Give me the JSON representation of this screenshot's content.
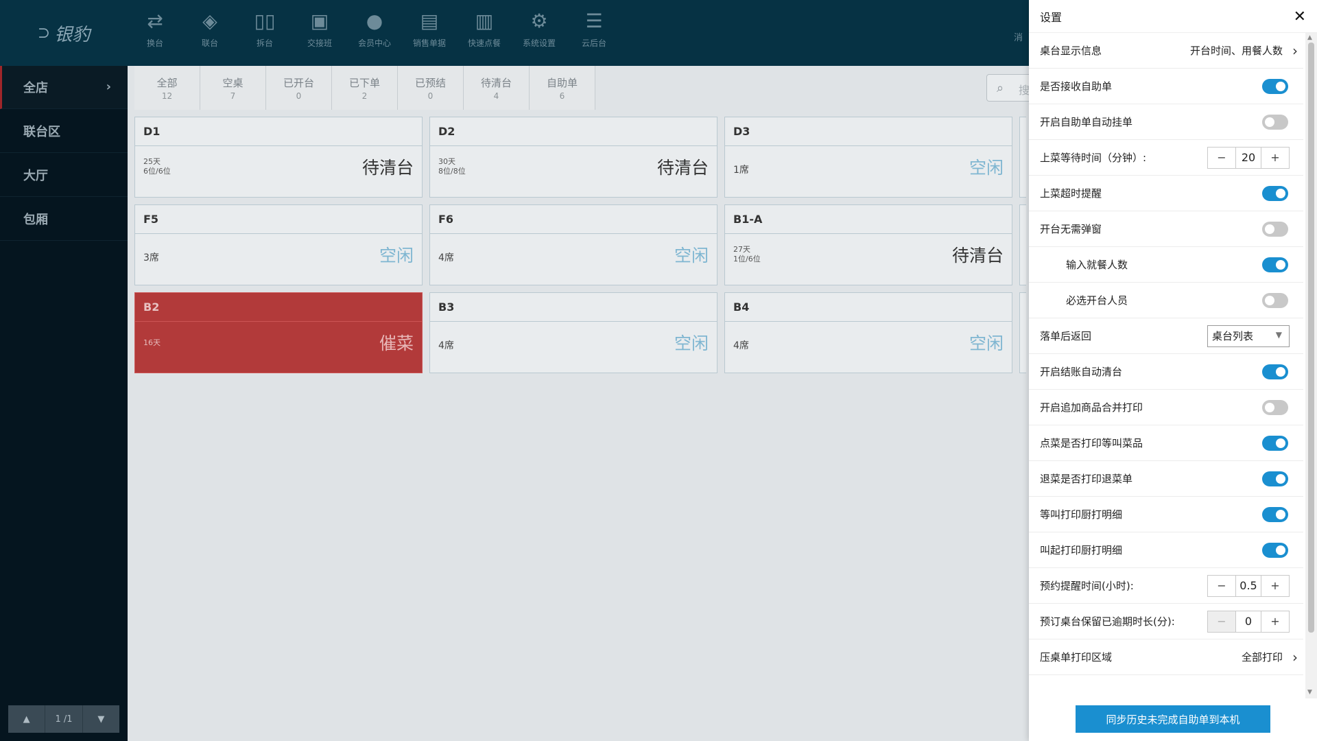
{
  "brand": {
    "name": "银豹"
  },
  "sidebar": {
    "items": [
      {
        "label": "全店",
        "active": true
      },
      {
        "label": "联台区"
      },
      {
        "label": "大厅"
      },
      {
        "label": "包厢"
      }
    ],
    "pager": {
      "page": "1 /1"
    }
  },
  "toolbar": {
    "items": [
      {
        "label": "换台",
        "icon": "swap-table-icon"
      },
      {
        "label": "联台",
        "icon": "link-table-icon"
      },
      {
        "label": "拆台",
        "icon": "split-table-icon"
      },
      {
        "label": "交接班",
        "icon": "shift-handover-icon"
      },
      {
        "label": "会员中心",
        "icon": "member-center-icon"
      },
      {
        "label": "销售单据",
        "icon": "sales-receipt-icon"
      },
      {
        "label": "快速点餐",
        "icon": "quick-order-icon"
      },
      {
        "label": "系统设置",
        "icon": "gear-icon"
      },
      {
        "label": "云后台",
        "icon": "cloud-backend-icon"
      }
    ],
    "partial_label": "消"
  },
  "filters": [
    {
      "name": "全部",
      "count": "12"
    },
    {
      "name": "空桌",
      "count": "7"
    },
    {
      "name": "已开台",
      "count": "0"
    },
    {
      "name": "已下单",
      "count": "2"
    },
    {
      "name": "已预结",
      "count": "0"
    },
    {
      "name": "待清台",
      "count": "4"
    },
    {
      "name": "自助单",
      "count": "6"
    }
  ],
  "search": {
    "partial_text": "搜"
  },
  "tables": [
    {
      "id": "D1",
      "line1": "25天",
      "line2": "6位/6位",
      "status": "待清台"
    },
    {
      "id": "D2",
      "line1": "30天",
      "line2": "8位/8位",
      "status": "待清台"
    },
    {
      "id": "D3",
      "seats": "1席",
      "status": "空闲"
    },
    {
      "id": "F5",
      "seats": "3席",
      "status": "空闲"
    },
    {
      "id": "F6",
      "seats": "4席",
      "status": "空闲"
    },
    {
      "id": "B1-A",
      "line1": "27天",
      "line2": "1位/6位",
      "status": "待清台"
    },
    {
      "id": "B2",
      "line1": "16天",
      "status": "催菜"
    },
    {
      "id": "B3",
      "seats": "4席",
      "status": "空闲"
    },
    {
      "id": "B4",
      "seats": "4席",
      "status": "空闲"
    }
  ],
  "settings": {
    "title": "设置",
    "rows": [
      {
        "label": "桌台显示信息",
        "value": "开台时间、用餐人数"
      },
      {
        "label": "是否接收自助单",
        "on": true
      },
      {
        "label": "开启自助单自动挂单",
        "on": false
      },
      {
        "label": "上菜等待时间（分钟）:",
        "value": "20"
      },
      {
        "label": "上菜超时提醒",
        "on": true
      },
      {
        "label": "开台无需弹窗",
        "on": false
      },
      {
        "label": "输入就餐人数",
        "on": true
      },
      {
        "label": "必选开台人员",
        "on": false
      },
      {
        "label": "落单后返回",
        "value": "桌台列表"
      },
      {
        "label": "开启结账自动清台",
        "on": true
      },
      {
        "label": "开启追加商品合并打印",
        "on": false
      },
      {
        "label": "点菜是否打印等叫菜品",
        "on": true
      },
      {
        "label": "退菜是否打印退菜单",
        "on": true
      },
      {
        "label": "等叫打印厨打明细",
        "on": true
      },
      {
        "label": "叫起打印厨打明细",
        "on": true
      },
      {
        "label": "预约提醒时间(小时):",
        "value": "0.5"
      },
      {
        "label": "预订桌台保留已逾期时长(分):",
        "value": "0"
      },
      {
        "label": "压桌单打印区域",
        "value": "全部打印"
      }
    ],
    "sync_button": "同步历史未完成自助单到本机"
  },
  "colors": {
    "accent": "#1a8fd0",
    "topbar": "#063244",
    "urge": "#b23a3a"
  }
}
